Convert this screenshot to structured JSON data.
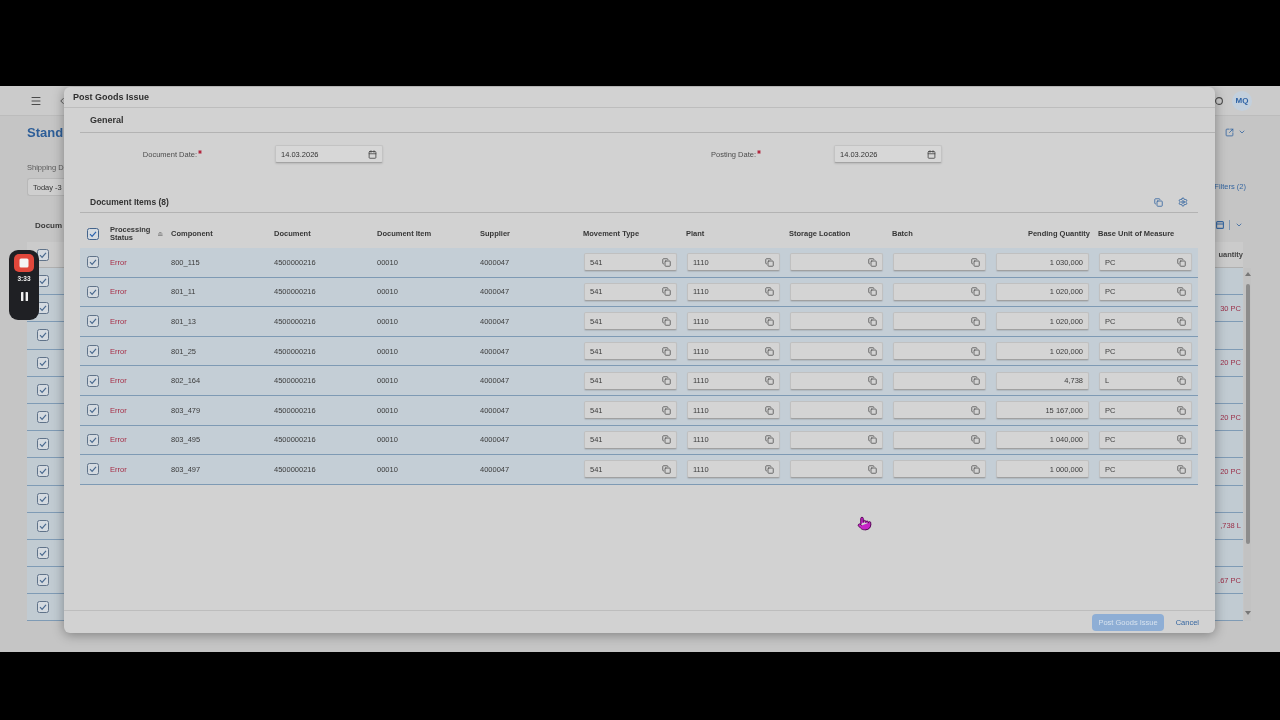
{
  "background_page": {
    "shell_bar": {
      "avatar": "MQ"
    },
    "title": "Stand",
    "filter": {
      "label": "Shipping D",
      "value": "Today -3"
    },
    "filters_link": "Filters (2)",
    "table": {
      "title": "Docum",
      "column": "uantity",
      "select_all": {
        "checked": true
      },
      "rows": [
        {
          "checked": true
        },
        {
          "checked": true,
          "quantity": "30 PC"
        },
        {
          "checked": true
        },
        {
          "checked": true,
          "quantity": "20 PC"
        },
        {
          "checked": true
        },
        {
          "checked": true,
          "quantity": "20 PC"
        },
        {
          "checked": true
        },
        {
          "checked": true,
          "quantity": "20 PC"
        },
        {
          "checked": true
        },
        {
          "checked": true,
          "quantity": ",738 L"
        },
        {
          "checked": true
        },
        {
          "checked": true,
          "quantity": ".67 PC"
        },
        {
          "checked": true
        }
      ]
    }
  },
  "recorder": {
    "time": "3:33"
  },
  "dialog": {
    "title": "Post Goods Issue",
    "general": {
      "title": "General",
      "fields": [
        {
          "label": "Document Date:",
          "required": true,
          "value": "14.03.2026"
        },
        {
          "label": "Posting Date:",
          "required": true,
          "value": "14.03.2026"
        }
      ]
    },
    "document_items": {
      "title": "Document Items (8)",
      "select_all": {
        "checked": true
      },
      "columns": [
        {
          "label": "Processing Status",
          "kind": "status",
          "sorted": true
        },
        {
          "label": "Component",
          "kind": "text",
          "sorted": false
        },
        {
          "label": "Document",
          "kind": "text",
          "sorted": false
        },
        {
          "label": "Document Item",
          "kind": "text",
          "sorted": false
        },
        {
          "label": "Supplier",
          "kind": "text",
          "sorted": false
        },
        {
          "label": "Movement Type",
          "kind": "input",
          "sorted": false
        },
        {
          "label": "Plant",
          "kind": "input",
          "sorted": false
        },
        {
          "label": "Storage Location",
          "kind": "input",
          "sorted": false
        },
        {
          "label": "Batch",
          "kind": "input",
          "sorted": false
        },
        {
          "label": "Pending Quantity",
          "kind": "number",
          "sorted": false
        },
        {
          "label": "Base Unit of Measure",
          "kind": "input",
          "sorted": false
        }
      ],
      "rows": [
        {
          "selected": true,
          "processing_status": "Error",
          "component": "800_115",
          "document": "4500000216",
          "document_item": "00010",
          "supplier": "4000047",
          "movement_type": "541",
          "plant": "1110",
          "pending_quantity": "1 030,000",
          "base_unit_of_measure": "PC"
        },
        {
          "selected": true,
          "processing_status": "Error",
          "component": "801_11",
          "document": "4500000216",
          "document_item": "00010",
          "supplier": "4000047",
          "movement_type": "541",
          "plant": "1110",
          "pending_quantity": "1 020,000",
          "base_unit_of_measure": "PC"
        },
        {
          "selected": true,
          "processing_status": "Error",
          "component": "801_13",
          "document": "4500000216",
          "document_item": "00010",
          "supplier": "4000047",
          "movement_type": "541",
          "plant": "1110",
          "pending_quantity": "1 020,000",
          "base_unit_of_measure": "PC"
        },
        {
          "selected": true,
          "processing_status": "Error",
          "component": "801_25",
          "document": "4500000216",
          "document_item": "00010",
          "supplier": "4000047",
          "movement_type": "541",
          "plant": "1110",
          "pending_quantity": "1 020,000",
          "base_unit_of_measure": "PC"
        },
        {
          "selected": true,
          "processing_status": "Error",
          "component": "802_164",
          "document": "4500000216",
          "document_item": "00010",
          "supplier": "4000047",
          "movement_type": "541",
          "plant": "1110",
          "pending_quantity": "4,738",
          "base_unit_of_measure": "L"
        },
        {
          "selected": true,
          "processing_status": "Error",
          "component": "803_479",
          "document": "4500000216",
          "document_item": "00010",
          "supplier": "4000047",
          "movement_type": "541",
          "plant": "1110",
          "pending_quantity": "15 167,000",
          "base_unit_of_measure": "PC"
        },
        {
          "selected": true,
          "processing_status": "Error",
          "component": "803_495",
          "document": "4500000216",
          "document_item": "00010",
          "supplier": "4000047",
          "movement_type": "541",
          "plant": "1110",
          "pending_quantity": "1 040,000",
          "base_unit_of_measure": "PC"
        },
        {
          "selected": true,
          "processing_status": "Error",
          "component": "803_497",
          "document": "4500000216",
          "document_item": "00010",
          "supplier": "4000047",
          "movement_type": "541",
          "plant": "1110",
          "pending_quantity": "1 000,000",
          "base_unit_of_measure": "PC"
        }
      ]
    },
    "footer": {
      "buttons": [
        {
          "label": "Post Goods Issue",
          "kind": "emphasized",
          "disabled": true
        },
        {
          "label": "Cancel",
          "kind": "transparent",
          "disabled": false
        }
      ]
    }
  }
}
